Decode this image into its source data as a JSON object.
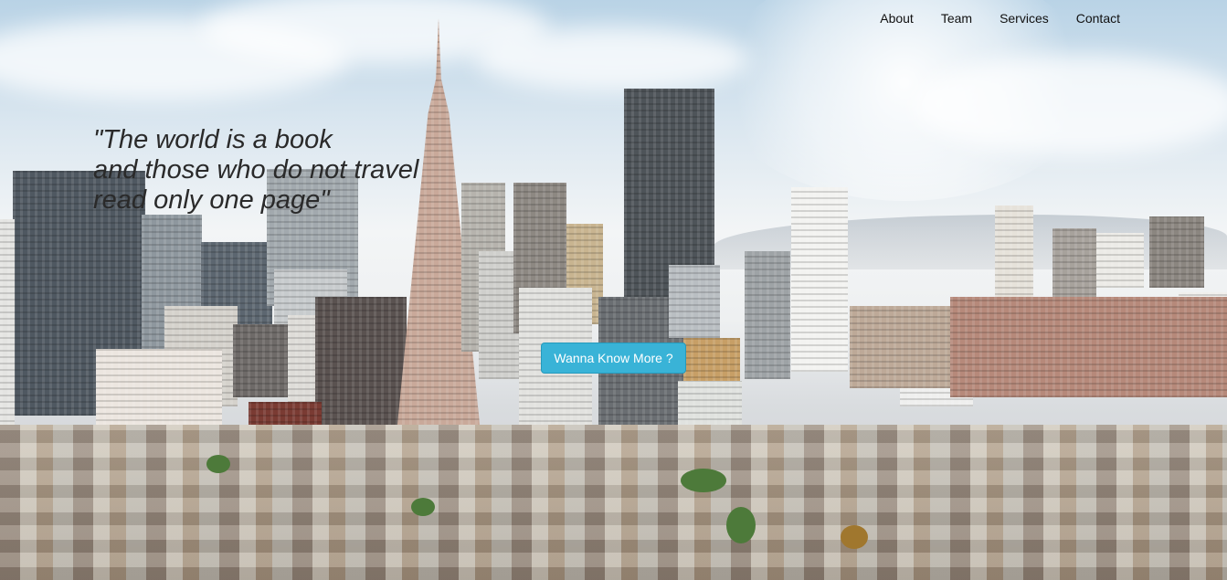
{
  "nav": {
    "items": [
      {
        "label": "About"
      },
      {
        "label": "Team"
      },
      {
        "label": "Services"
      },
      {
        "label": "Contact"
      }
    ]
  },
  "hero": {
    "quote_lines": [
      "\"The world is a book",
      "and those who do not travel",
      "read only one page\""
    ],
    "cta_label": "Wanna Know More ?"
  },
  "colors": {
    "cta_background": "#39b3d7",
    "nav_text": "#111111",
    "quote_text": "#2a2a2a"
  }
}
